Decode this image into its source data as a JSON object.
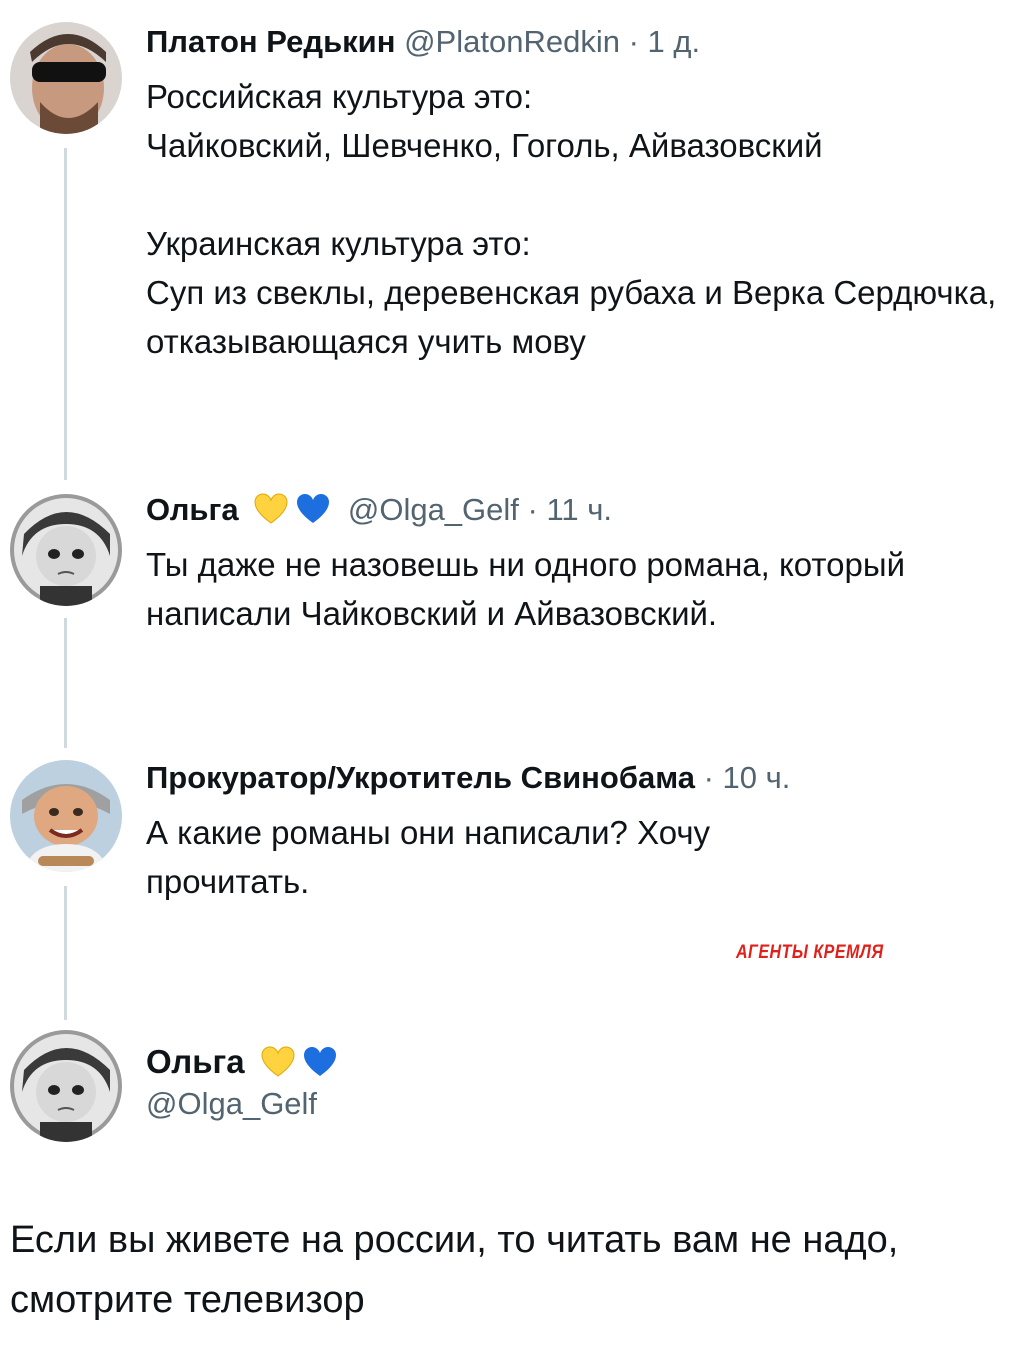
{
  "tweets": [
    {
      "name": "Платон Редькин",
      "handle": "@PlatonRedkin",
      "time": "· 1 д.",
      "text": "Российская культура это:\nЧайковский, Шевченко, Гоголь, Айвазовский\n\nУкраинская культура это:\nСуп из свеклы, деревенская рубаха и Верка Сердючка, отказывающаяся учить мову"
    },
    {
      "name": "Ольга",
      "handle": "@Olga_Gelf",
      "time": "· 11 ч.",
      "text": "Ты даже не назовешь ни одного романа, который написали Чайковский и Айвазовский."
    },
    {
      "name": "Прокуратор/Укротитель Свинобама",
      "handle": "",
      "time": "· 10 ч.",
      "text": "А какие романы они написали? Хочу прочитать."
    }
  ],
  "final_tweet": {
    "name": "Ольга",
    "handle": "@Olga_Gelf",
    "text": "Если вы живете на россии, то читать вам не надо, смотрите телевизор"
  },
  "watermark": "АГЕНТЫ КРЕМЛЯ",
  "colors": {
    "text": "#0f1419",
    "secondary": "#536471",
    "thread_line": "#cfd9de",
    "yellow_heart": "#ffd23f",
    "blue_heart": "#1d6fe0",
    "watermark": "#e0211b"
  },
  "icons": [
    "yellow-heart-icon",
    "blue-heart-icon"
  ]
}
